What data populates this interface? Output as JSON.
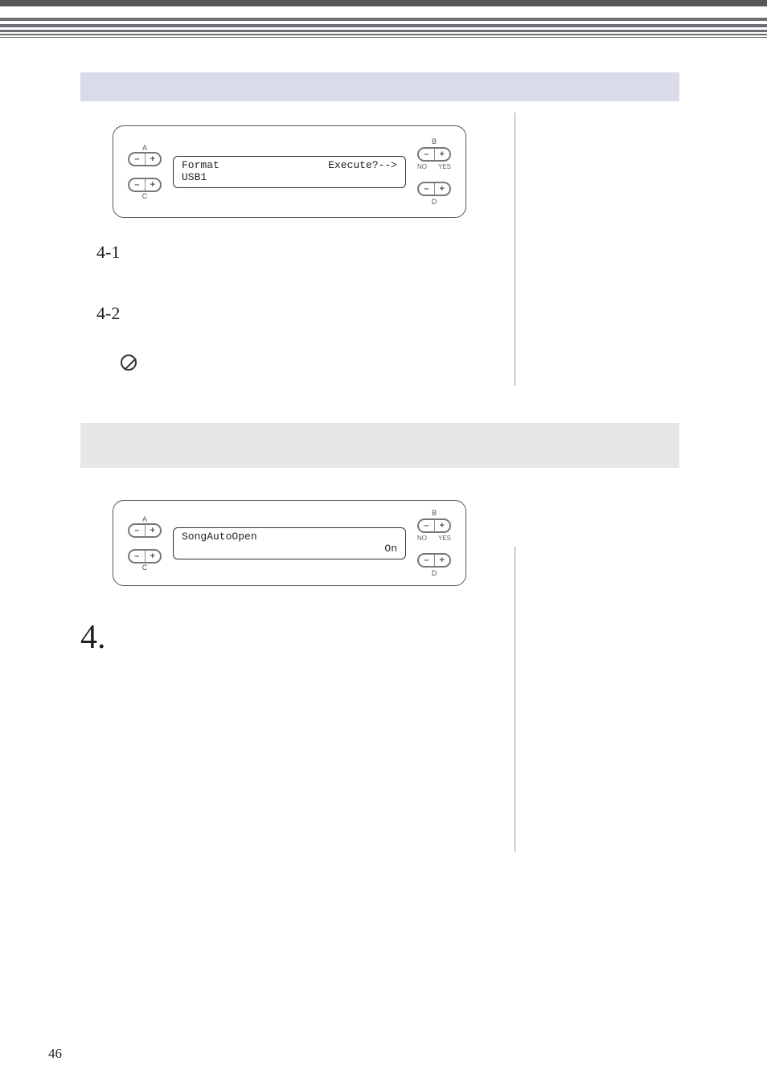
{
  "page_number": "46",
  "labels": {
    "A": "A",
    "B": "B",
    "C": "C",
    "D": "D",
    "minus": "–",
    "plus": "+",
    "NO": "NO",
    "YES": "YES"
  },
  "lcd1": {
    "line1_left": "Format",
    "line1_right": "Execute?-->",
    "line2": "USB1"
  },
  "lcd2": {
    "line1": "SongAutoOpen",
    "line2_right": "On"
  },
  "steps": {
    "s41": "4-1",
    "s42": "4-2",
    "s4big": "4."
  }
}
